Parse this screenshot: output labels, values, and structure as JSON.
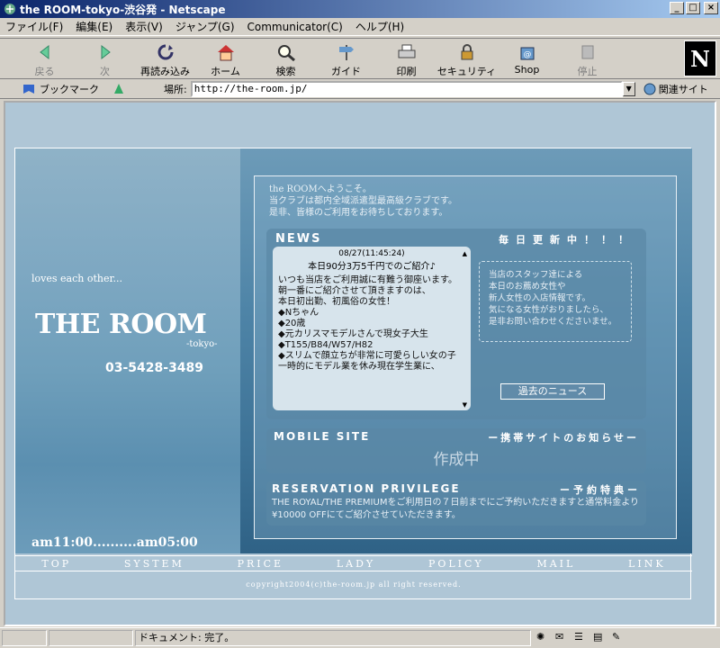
{
  "window": {
    "title": "the ROOM-tokyo-渋谷発 - Netscape"
  },
  "menu": [
    "ファイル(F)",
    "編集(E)",
    "表示(V)",
    "ジャンプ(G)",
    "Communicator(C)",
    "ヘルプ(H)"
  ],
  "toolbar": [
    {
      "label": "戻る",
      "icon": "back-arrow-icon"
    },
    {
      "label": "次",
      "icon": "forward-arrow-icon"
    },
    {
      "label": "再読み込み",
      "icon": "reload-icon"
    },
    {
      "label": "ホーム",
      "icon": "home-icon"
    },
    {
      "label": "検索",
      "icon": "search-icon"
    },
    {
      "label": "ガイド",
      "icon": "guide-icon"
    },
    {
      "label": "印刷",
      "icon": "print-icon"
    },
    {
      "label": "セキュリティ",
      "icon": "security-lock-icon"
    },
    {
      "label": "Shop",
      "icon": "shop-icon"
    },
    {
      "label": "停止",
      "icon": "stop-icon"
    }
  ],
  "location": {
    "bookmarks": "ブックマーク",
    "label": "場所:",
    "url": "http://the-room.jp/",
    "related": "関連サイト"
  },
  "page": {
    "loves": "loves each other...",
    "logo": "THE ROOM",
    "tokyo": "-tokyo-",
    "phone": "03-5428-3489",
    "hours": "am11:00..........am05:00",
    "welcome": [
      "the ROOMへようこそ。",
      "当クラブは都内全域派遣型最高級クラブです。",
      "是非、皆様のご利用をお待ちしております。"
    ],
    "news_title": "NEWS",
    "daily_update": "毎日更新中！！！",
    "news_date": "08/27(11:45:24)",
    "news_headline": "本日90分3万5千円でのご紹介♪",
    "news_body": [
      "いつも当店をご利用誠に有難う御座います。",
      "朝一番にご紹介させて頂きますのは、",
      "本日初出勤、初風俗の女性！",
      "◆Nちゃん",
      "◆20歳",
      "◆元カリスマモデルさんで現女子大生",
      "◆T155/B84/W57/H82",
      "◆スリムで顔立ちが非常に可愛らしい女の子",
      "一時的にモデル業を休み現在学生業に、"
    ],
    "staff_info": [
      "当店のスタッフ達による",
      "本日のお薦め女性や",
      "新人女性の入店情報です。",
      "気になる女性がおりましたら、",
      "是非お問い合わせくださいませ。"
    ],
    "past_news": "過去のニュース",
    "mobile_title": "MOBILE SITE",
    "mobile_note": "ー携帯サイトのお知らせー",
    "mobile_status": "作成中",
    "res_title": "RESERVATION PRIVILEGE",
    "res_note": "ー予約特典ー",
    "res_text": "THE ROYAL/THE PREMIUMをご利用日の７日前までにご予約いただきますと通常料金より¥10000 OFFにてご紹介させていただきます。",
    "nav": [
      "TOP",
      "SYSTEM",
      "PRICE",
      "LADY",
      "POLICY",
      "MAIL",
      "LINK"
    ],
    "copyright": "copyright2004(c)the-room.jp all right reserved."
  },
  "status": {
    "text": "ドキュメント: 完了。"
  }
}
